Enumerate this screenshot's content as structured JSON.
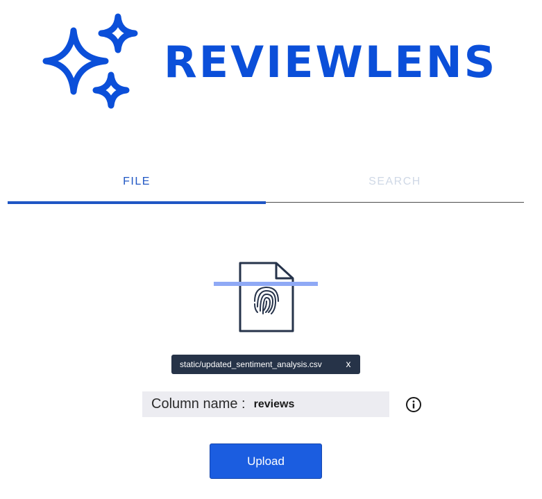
{
  "brand": {
    "name": "REVIEWLENS",
    "icon": "sparkles-icon",
    "color": "#0b4fd9"
  },
  "tabs": [
    {
      "label": "FILE",
      "active": true
    },
    {
      "label": "SEARCH",
      "active": false
    }
  ],
  "colors": {
    "accent": "#1f56c4",
    "inactive_tab": "#cfd8e6",
    "scan_line": "#8fa9f5",
    "chip_bg": "#263348",
    "button_bg": "#1b5de0"
  },
  "upload_area": {
    "icon": "fingerprint-file-icon"
  },
  "selected_file": {
    "name": "static/updated_sentiment_analysis.csv",
    "remove_label": "x"
  },
  "column_field": {
    "label": "Column name :",
    "value": "reviews"
  },
  "info": {
    "icon": "info-icon"
  },
  "actions": {
    "upload_label": "Upload"
  }
}
